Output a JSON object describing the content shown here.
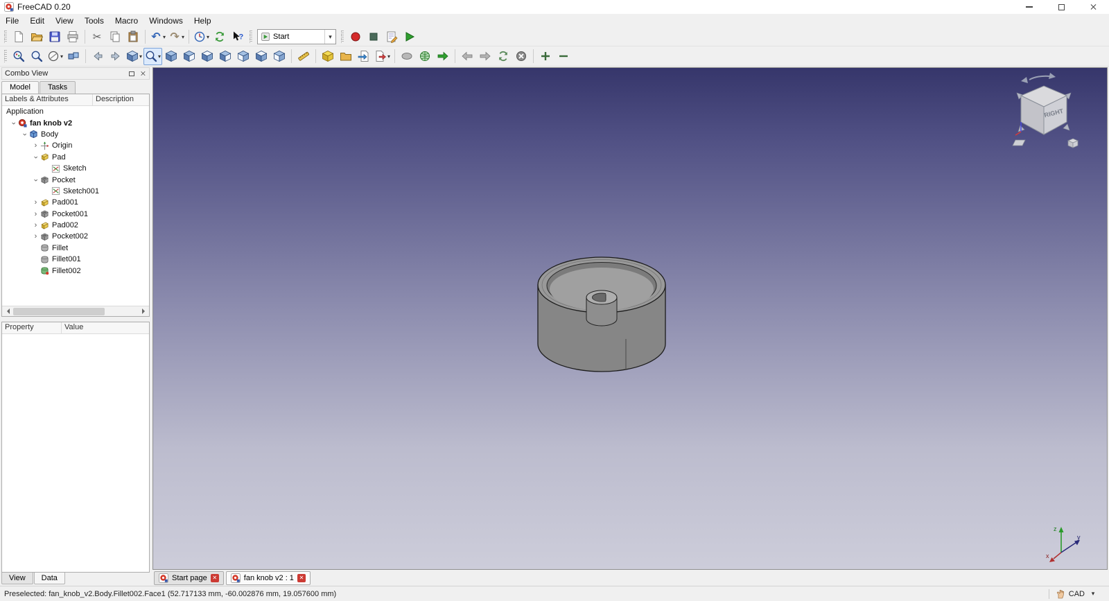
{
  "window": {
    "title": "FreeCAD 0.20",
    "controls": [
      "minimize",
      "maximize",
      "close"
    ]
  },
  "menubar": {
    "items": [
      "File",
      "Edit",
      "View",
      "Tools",
      "Macro",
      "Windows",
      "Help"
    ]
  },
  "toolbars": {
    "standard": [
      {
        "name": "new-document",
        "icon": "new-file-icon"
      },
      {
        "name": "open-document",
        "icon": "open-folder-icon"
      },
      {
        "name": "save-document",
        "icon": "save-icon"
      },
      {
        "name": "print",
        "icon": "print-icon"
      },
      {
        "sep": true
      },
      {
        "name": "cut",
        "icon": "cut-icon"
      },
      {
        "name": "copy",
        "icon": "copy-icon"
      },
      {
        "name": "paste",
        "icon": "paste-icon"
      },
      {
        "sep": true
      },
      {
        "name": "undo",
        "icon": "undo-icon",
        "dropdown": true
      },
      {
        "name": "redo",
        "icon": "redo-icon",
        "dropdown": true
      },
      {
        "sep": true
      },
      {
        "name": "recompute",
        "icon": "recompute-icon",
        "dropdown": true
      },
      {
        "name": "refresh",
        "icon": "refresh-icon"
      },
      {
        "name": "whats-this",
        "icon": "whatsthis-icon"
      }
    ],
    "workbench": {
      "selected": "Start"
    },
    "macro": [
      {
        "name": "macro-record",
        "icon": "record-icon"
      },
      {
        "name": "macro-stop",
        "icon": "stop-icon"
      },
      {
        "name": "macro-edit",
        "icon": "edit-macro-icon"
      },
      {
        "name": "macro-execute",
        "icon": "play-icon"
      }
    ],
    "view": [
      {
        "name": "fit-all",
        "icon": "fit-all-icon"
      },
      {
        "name": "fit-selection",
        "icon": "fit-selection-icon"
      },
      {
        "name": "draw-style",
        "icon": "draw-style-icon",
        "dropdown": true
      },
      {
        "name": "sync-view",
        "icon": "sync-view-icon"
      },
      {
        "sep": true
      },
      {
        "name": "select-back",
        "icon": "nav-arrow-left-icon"
      },
      {
        "name": "select-forward",
        "icon": "nav-arrow-right-icon"
      },
      {
        "name": "view-group",
        "icon": "scene-icon",
        "dropdown": true
      },
      {
        "name": "zoom-tool",
        "icon": "zoom-magnifier-icon",
        "dropdown": true,
        "active": true
      },
      {
        "name": "view-isometric",
        "icon": "cube-isometric-icon"
      },
      {
        "name": "view-front",
        "icon": "cube-front-icon"
      },
      {
        "name": "view-top",
        "icon": "cube-top-icon"
      },
      {
        "name": "view-right",
        "icon": "cube-right-icon"
      },
      {
        "name": "view-rear",
        "icon": "cube-rear-icon"
      },
      {
        "name": "view-bottom",
        "icon": "cube-bottom-icon"
      },
      {
        "name": "view-left",
        "icon": "cube-left-icon"
      },
      {
        "sep": true
      },
      {
        "name": "measure-distance",
        "icon": "measure-icon"
      },
      {
        "sep": true
      },
      {
        "name": "new-part",
        "icon": "part-icon"
      },
      {
        "name": "open-start-folder",
        "icon": "folder-icon"
      },
      {
        "name": "import-file",
        "icon": "import-icon"
      },
      {
        "name": "export-file",
        "icon": "export-icon",
        "dropdown": true
      },
      {
        "sep": true
      },
      {
        "name": "web-page",
        "icon": "ellipse-icon"
      },
      {
        "name": "open-website",
        "icon": "globe-icon"
      },
      {
        "name": "go",
        "icon": "go-arrow-icon"
      },
      {
        "sep": true
      },
      {
        "name": "browser-back",
        "icon": "back-icon"
      },
      {
        "name": "browser-forward",
        "icon": "forward-icon"
      },
      {
        "name": "browser-refresh",
        "icon": "reload-icon"
      },
      {
        "name": "browser-stop",
        "icon": "stop-load-icon"
      },
      {
        "sep": true
      },
      {
        "name": "zoom-in",
        "icon": "zoom-in-icon"
      },
      {
        "name": "zoom-out",
        "icon": "zoom-out-icon"
      }
    ]
  },
  "combo_view": {
    "title": "Combo View",
    "tabs": [
      {
        "label": "Model",
        "active": true
      },
      {
        "label": "Tasks",
        "active": false
      }
    ],
    "tree_headers": [
      "Labels & Attributes",
      "Description"
    ],
    "tree_items": [
      {
        "label": "Application",
        "depth": 0,
        "expander": "none",
        "icon": "none",
        "bold": false
      },
      {
        "label": "fan knob v2",
        "depth": 1,
        "expander": "expanded",
        "icon": "document-icon",
        "bold": true
      },
      {
        "label": "Body",
        "depth": 2,
        "expander": "expanded",
        "icon": "body-icon",
        "bold": false
      },
      {
        "label": "Origin",
        "depth": 3,
        "expander": "collapsed",
        "icon": "origin-icon",
        "bold": false
      },
      {
        "label": "Pad",
        "depth": 3,
        "expander": "expanded",
        "icon": "pad-icon",
        "bold": false
      },
      {
        "label": "Sketch",
        "depth": 4,
        "expander": "none",
        "icon": "sketch-icon",
        "bold": false
      },
      {
        "label": "Pocket",
        "depth": 3,
        "expander": "expanded",
        "icon": "pocket-icon",
        "bold": false
      },
      {
        "label": "Sketch001",
        "depth": 4,
        "expander": "none",
        "icon": "sketch-icon",
        "bold": false
      },
      {
        "label": "Pad001",
        "depth": 3,
        "expander": "collapsed",
        "icon": "pad-icon",
        "bold": false
      },
      {
        "label": "Pocket001",
        "depth": 3,
        "expander": "collapsed",
        "icon": "pocket-icon",
        "bold": false
      },
      {
        "label": "Pad002",
        "depth": 3,
        "expander": "collapsed",
        "icon": "pad-icon",
        "bold": false
      },
      {
        "label": "Pocket002",
        "depth": 3,
        "expander": "collapsed",
        "icon": "pocket-icon",
        "bold": false
      },
      {
        "label": "Fillet",
        "depth": 3,
        "expander": "none",
        "icon": "fillet-icon",
        "bold": false
      },
      {
        "label": "Fillet001",
        "depth": 3,
        "expander": "none",
        "icon": "fillet-icon",
        "bold": false
      },
      {
        "label": "Fillet002",
        "depth": 3,
        "expander": "none",
        "icon": "fillet-highlight-icon",
        "bold": false
      }
    ],
    "property_headers": [
      "Property",
      "Value"
    ],
    "bottom_tabs": [
      {
        "label": "View",
        "active": false
      },
      {
        "label": "Data",
        "active": true
      }
    ]
  },
  "viewport": {
    "nav_cube_label": "RIGHT",
    "axes": {
      "x": "x",
      "y": "y",
      "z": "z"
    }
  },
  "document_tabs": [
    {
      "label": "Start page",
      "active": false
    },
    {
      "label": "fan knob v2 : 1",
      "active": true
    }
  ],
  "statusbar": {
    "message": "Preselected: fan_knob_v2.Body.Fillet002.Face1 (52.717133 mm, -60.002876 mm, 19.057600 mm)",
    "nav_style": "CAD"
  }
}
